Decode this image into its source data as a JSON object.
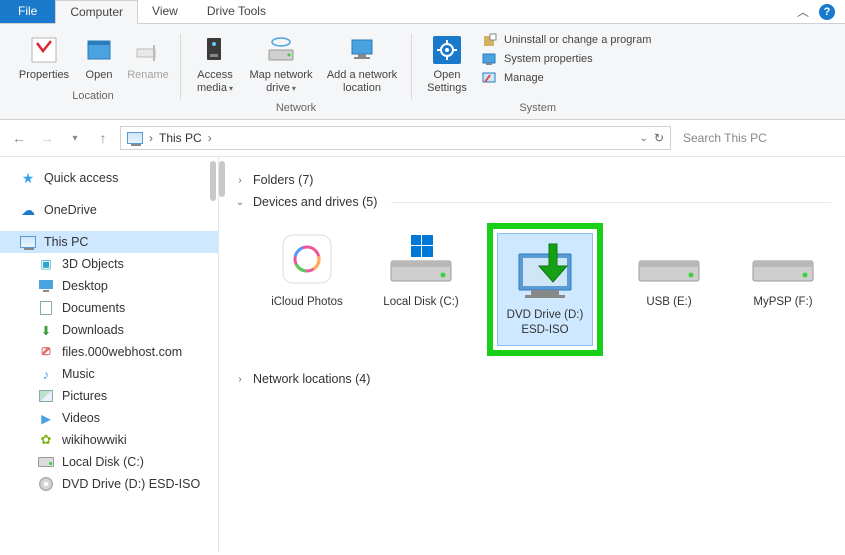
{
  "tabs": {
    "file": "File",
    "computer": "Computer",
    "view": "View",
    "drivetools": "Drive Tools"
  },
  "ribbon": {
    "location": {
      "label": "Location",
      "properties": "Properties",
      "open": "Open",
      "rename": "Rename"
    },
    "network": {
      "label": "Network",
      "access_media": "Access media",
      "map_drive": "Map network drive",
      "add_location": "Add a network location"
    },
    "system": {
      "label": "System",
      "open_settings": "Open Settings",
      "uninstall": "Uninstall or change a program",
      "sysprops": "System properties",
      "manage": "Manage"
    }
  },
  "address": {
    "location": "This PC",
    "search_placeholder": "Search This PC"
  },
  "nav": {
    "quick_access": "Quick access",
    "onedrive": "OneDrive",
    "this_pc": "This PC",
    "items": [
      "3D Objects",
      "Desktop",
      "Documents",
      "Downloads",
      "files.000webhost.com",
      "Music",
      "Pictures",
      "Videos",
      "wikihowwiki",
      "Local Disk (C:)",
      "DVD Drive (D:) ESD-ISO"
    ]
  },
  "content": {
    "folders_label": "Folders (7)",
    "devices_label": "Devices and drives (5)",
    "network_label": "Network locations (4)",
    "drives": [
      {
        "name": "iCloud Photos",
        "type": "app"
      },
      {
        "name": "Local Disk (C:)",
        "type": "hdd"
      },
      {
        "name": "DVD Drive (D:) ESD-ISO",
        "type": "dvd",
        "highlighted": true
      },
      {
        "name": "USB (E:)",
        "type": "hdd"
      },
      {
        "name": "MyPSP (F:)",
        "type": "hdd"
      }
    ]
  }
}
